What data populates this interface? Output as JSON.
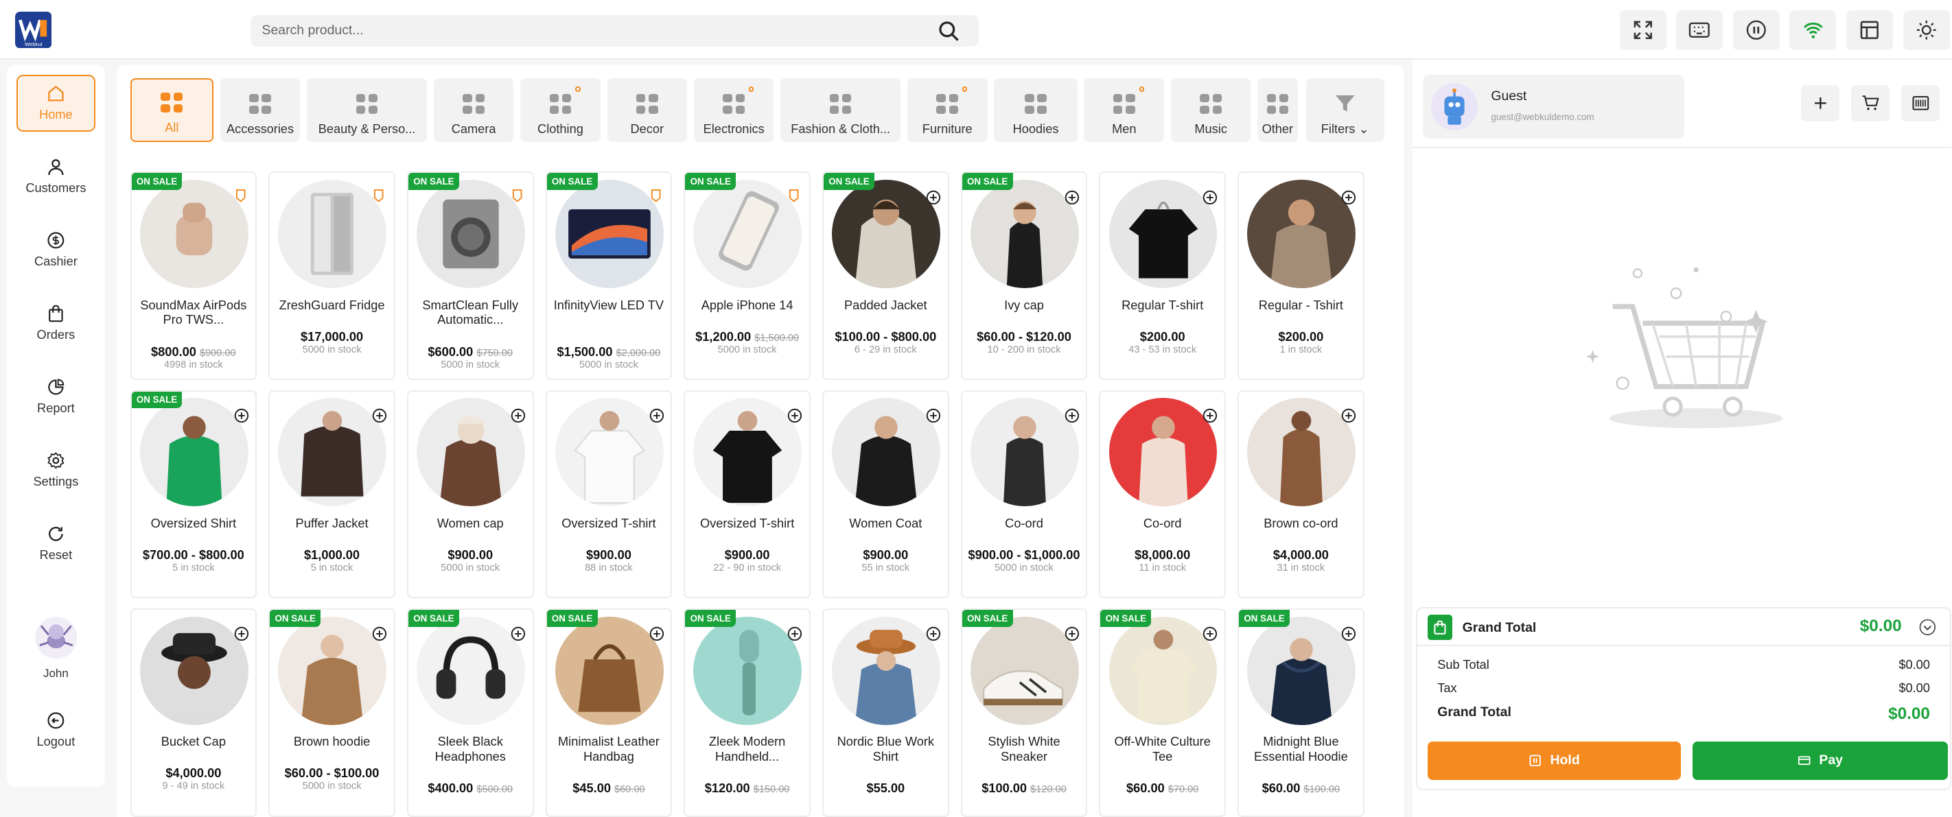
{
  "header": {
    "search_placeholder": "Search product...",
    "logo_text": "Webkul",
    "buttons": [
      "fullscreen-icon",
      "keyboard-icon",
      "pause-icon",
      "wifi-icon",
      "layout-icon",
      "sun-icon"
    ]
  },
  "sidebar": {
    "items": [
      {
        "label": "Home",
        "icon": "home-icon",
        "active": true
      },
      {
        "label": "Customers",
        "icon": "user-icon"
      },
      {
        "label": "Cashier",
        "icon": "dollar-icon"
      },
      {
        "label": "Orders",
        "icon": "bag-icon"
      },
      {
        "label": "Report",
        "icon": "pie-icon"
      },
      {
        "label": "Settings",
        "icon": "gear-icon"
      },
      {
        "label": "Reset",
        "icon": "refresh-icon"
      }
    ],
    "user": {
      "name": "John"
    },
    "logout_label": "Logout"
  },
  "categories": [
    {
      "label": "All",
      "active": true
    },
    {
      "label": "Accessories"
    },
    {
      "label": "Beauty & Perso..."
    },
    {
      "label": "Camera"
    },
    {
      "label": "Clothing",
      "dot": true
    },
    {
      "label": "Decor"
    },
    {
      "label": "Electronics",
      "dot": true
    },
    {
      "label": "Fashion & Cloth..."
    },
    {
      "label": "Furniture",
      "dot": true
    },
    {
      "label": "Hoodies"
    },
    {
      "label": "Men",
      "dot": true
    },
    {
      "label": "Music"
    },
    {
      "label": "Other"
    }
  ],
  "filters_label": "Filters",
  "sale_badge": "ON SALE",
  "products": [
    {
      "name": "SoundMax AirPods Pro TWS...",
      "price": "$800.00",
      "old": "$900.00",
      "stock": "4998 in stock",
      "sale": true,
      "pin": true
    },
    {
      "name": "ZreshGuard Fridge",
      "price": "$17,000.00",
      "stock": "5000 in stock",
      "pin": true
    },
    {
      "name": "SmartClean Fully Automatic...",
      "price": "$600.00",
      "old": "$750.00",
      "stock": "5000 in stock",
      "sale": true,
      "pin": true
    },
    {
      "name": "InfinityView LED TV",
      "price": "$1,500.00",
      "old": "$2,000.00",
      "stock": "5000 in stock",
      "sale": true,
      "pin": true
    },
    {
      "name": "Apple iPhone 14",
      "price": "$1,200.00",
      "old": "$1,500.00",
      "stock": "5000 in stock",
      "sale": true,
      "pin": true
    },
    {
      "name": "Padded Jacket",
      "price": "$100.00 - $800.00",
      "stock": "6 - 29 in stock",
      "sale": true
    },
    {
      "name": "Ivy cap",
      "price": "$60.00 - $120.00",
      "stock": "10 - 200 in stock",
      "sale": true
    },
    {
      "name": "Regular T-shirt",
      "price": "$200.00",
      "stock": "43 - 53 in stock"
    },
    {
      "name": "Regular - Tshirt",
      "price": "$200.00",
      "stock": "1 in stock"
    },
    {
      "name": "Oversized Shirt",
      "price": "$700.00 - $800.00",
      "stock": "5 in stock",
      "sale": true
    },
    {
      "name": "Puffer Jacket",
      "price": "$1,000.00",
      "stock": "5 in stock"
    },
    {
      "name": "Women cap",
      "price": "$900.00",
      "stock": "5000 in stock"
    },
    {
      "name": "Oversized T-shirt",
      "price": "$900.00",
      "stock": "88 in stock"
    },
    {
      "name": "Oversized T-shirt",
      "price": "$900.00",
      "stock": "22 - 90 in stock"
    },
    {
      "name": "Women Coat",
      "price": "$900.00",
      "stock": "55 in stock"
    },
    {
      "name": "Co-ord",
      "price": "$900.00 - $1,000.00",
      "stock": "5000 in stock"
    },
    {
      "name": "Co-ord",
      "price": "$8,000.00",
      "stock": "11 in stock"
    },
    {
      "name": "Brown co-ord",
      "price": "$4,000.00",
      "stock": "31 in stock"
    },
    {
      "name": "Bucket Cap",
      "price": "$4,000.00",
      "stock": "9 - 49 in stock"
    },
    {
      "name": "Brown hoodie",
      "price": "$60.00 - $100.00",
      "stock": "5000 in stock",
      "sale": true
    },
    {
      "name": "Sleek Black Headphones",
      "price": "$400.00",
      "old": "$500.00",
      "stock": "",
      "sale": true
    },
    {
      "name": "Minimalist Leather Handbag",
      "price": "$45.00",
      "old": "$60.00",
      "stock": "",
      "sale": true
    },
    {
      "name": "Zleek Modern Handheld...",
      "price": "$120.00",
      "old": "$150.00",
      "stock": "",
      "sale": true
    },
    {
      "name": "Nordic Blue Work Shirt",
      "price": "$55.00",
      "stock": ""
    },
    {
      "name": "Stylish White Sneaker",
      "price": "$100.00",
      "old": "$120.00",
      "stock": "",
      "sale": true
    },
    {
      "name": "Off-White Culture Tee",
      "price": "$60.00",
      "old": "$70.00",
      "stock": "",
      "sale": true
    },
    {
      "name": "Midnight Blue Essential Hoodie",
      "price": "$60.00",
      "old": "$100.00",
      "stock": "",
      "sale": true
    }
  ],
  "customer": {
    "name": "Guest",
    "email": "guest@webkuldemo.com"
  },
  "totals": {
    "grand_total_label": "Grand Total",
    "grand_total": "$0.00",
    "sub_total_label": "Sub Total",
    "sub_total": "$0.00",
    "tax_label": "Tax",
    "tax": "$0.00"
  },
  "actions": {
    "hold": "Hold",
    "pay": "Pay"
  },
  "colors": {
    "accent": "#f58a1f",
    "success": "#1aa33a"
  }
}
